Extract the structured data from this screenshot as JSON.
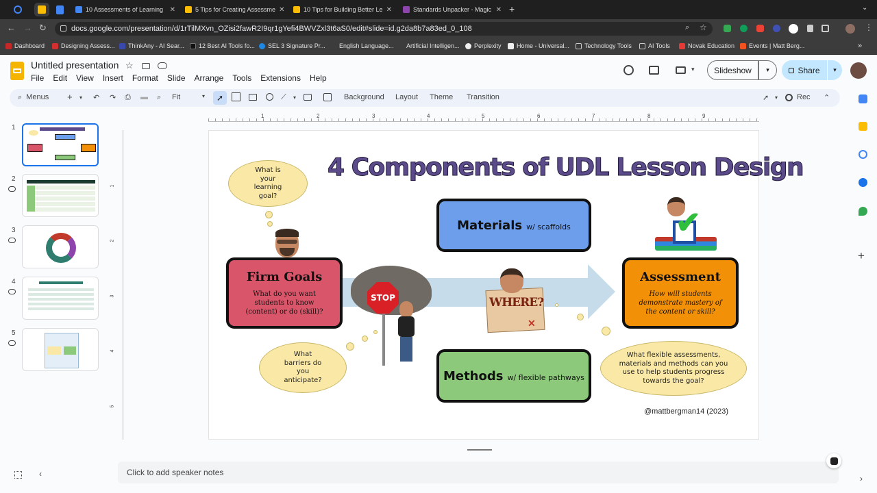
{
  "browser": {
    "tabs": [
      {
        "label": "10 Assessments of Learning",
        "color": "#4285f4"
      },
      {
        "label": "5 Tips for Creating Assessme",
        "color": "#fbbc04"
      },
      {
        "label": "10 Tips for Building Better Le",
        "color": "#fbbc04"
      },
      {
        "label": "Standards Unpacker - Magic",
        "color": "#8e44ad"
      }
    ],
    "url": "docs.google.com/presentation/d/1rTilMXvn_OZisi2fawR2I9qr1gYefi4BWVZxl3t6aS0/edit#slide=id.g2da8b7a83ed_0_108",
    "bookmarks": [
      "Dashboard",
      "Designing Assess...",
      "ThinkAny - AI Sear...",
      "12 Best AI Tools fo...",
      "SEL 3 Signature Pr...",
      "English Language...",
      "Artificial Intelligen...",
      "Perplexity",
      "Home - Universal...",
      "Technology Tools",
      "AI Tools",
      "Novak Education",
      "Events | Matt Berg..."
    ]
  },
  "docs": {
    "title": "Untitled presentation",
    "menu": [
      "File",
      "Edit",
      "View",
      "Insert",
      "Format",
      "Slide",
      "Arrange",
      "Tools",
      "Extensions",
      "Help"
    ],
    "slideshow_label": "Slideshow",
    "share_label": "Share",
    "toolbar": {
      "menus_label": "Menus",
      "zoom": "Fit",
      "background": "Background",
      "layout": "Layout",
      "theme": "Theme",
      "transition": "Transition",
      "rec": "Rec"
    },
    "ruler": [
      "1",
      "2",
      "3",
      "4",
      "5",
      "6",
      "7",
      "8",
      "9"
    ],
    "vruler": [
      "1",
      "2",
      "3",
      "4",
      "5"
    ],
    "slide_numbers": [
      "1",
      "2",
      "3",
      "4",
      "5"
    ],
    "notes_placeholder": "Click to add speaker notes"
  },
  "slide": {
    "title": "4 Components of UDL Lesson Design",
    "goal_cloud": "What is your learning goal?",
    "materials": {
      "main": "Materials",
      "sub": "w/ scaffolds"
    },
    "firm_goals": {
      "title": "Firm Goals",
      "body": "What do you want students to know (content) or do (skill)?"
    },
    "assessment": {
      "title": "Assessment",
      "body": "How will students demonstrate mastery of the content or skill?"
    },
    "methods": {
      "main": "Methods",
      "sub": "w/ flexible pathways"
    },
    "stop_sign": "STOP",
    "where_sign": "WHERE?",
    "barriers_cloud": "What barriers do you anticipate?",
    "flexible_cloud": "What flexible assessments, materials and methods can you use to help students progress towards the goal?",
    "credit": "@mattbergman14 (2023)",
    "colors": {
      "title": "#5b4b8a",
      "materials": "#6d9eeb",
      "firm_goals": "#d9566a",
      "assessment": "#f29007",
      "methods": "#8cc97b",
      "arrow": "#c7dcea",
      "cloud": "#fae9a6"
    }
  }
}
